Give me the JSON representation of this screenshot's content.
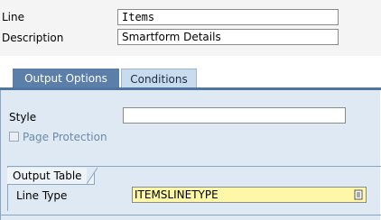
{
  "header": {
    "line_label": "Line",
    "line_value": "Items",
    "description_label": "Description",
    "description_value": "Smartform Details"
  },
  "tabs": [
    {
      "label": "Output Options",
      "active": true
    },
    {
      "label": "Conditions",
      "active": false
    }
  ],
  "output_options": {
    "style_label": "Style",
    "style_value": "",
    "page_protection_label": "Page Protection",
    "page_protection_checked": false,
    "output_table_title": "Output Table",
    "line_type_label": "Line Type",
    "line_type_value": "ITEMSLINETYPE"
  }
}
